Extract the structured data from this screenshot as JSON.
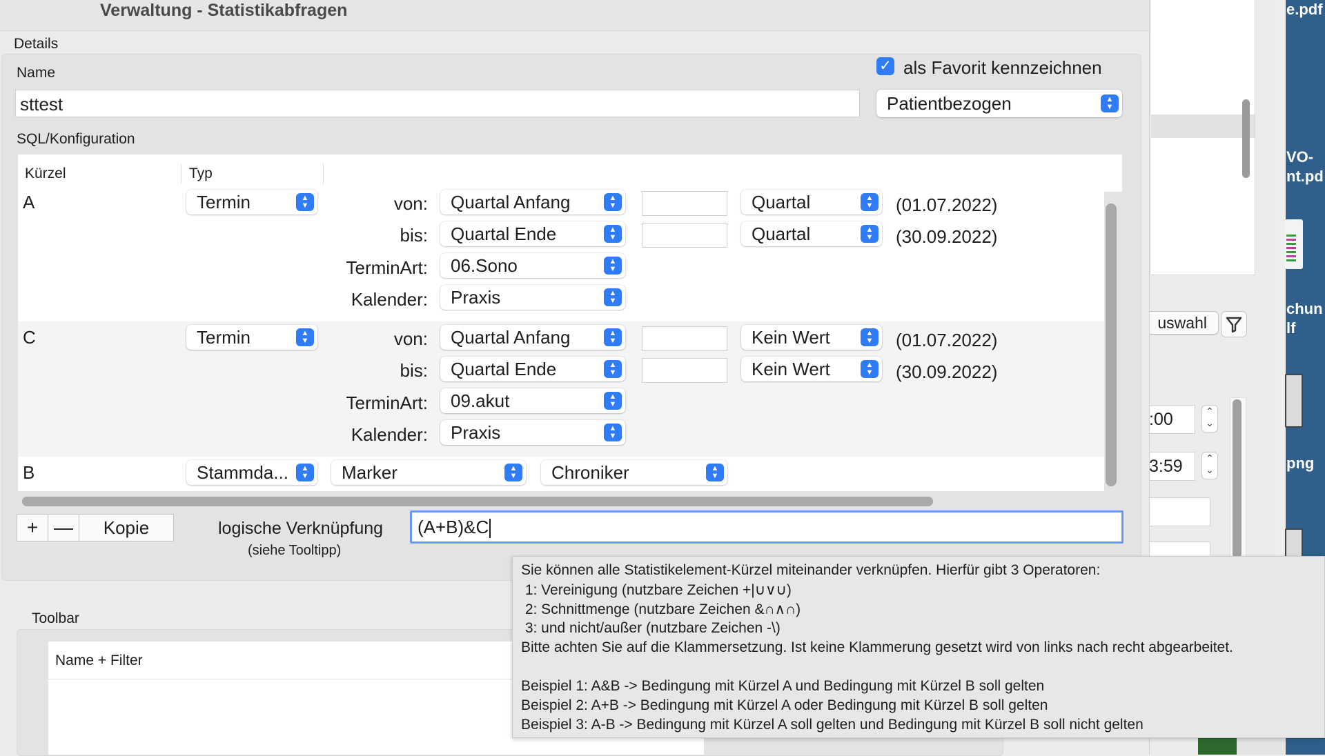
{
  "window": {
    "title": "Verwaltung - Statistikabfragen"
  },
  "details": {
    "section_label": "Details",
    "name_label": "Name",
    "name_value": "sttest",
    "favorite_label": "als Favorit kennzeichnen",
    "favorite_checked": true,
    "scope_select": "Patientbezogen",
    "sql_label": "SQL/Konfiguration"
  },
  "table": {
    "headers": {
      "kuerzel": "Kürzel",
      "typ": "Typ"
    },
    "row_a": {
      "kuerzel": "A",
      "typ": "Termin",
      "von_label": "von:",
      "von_select": "Quartal Anfang",
      "von_unit": "Quartal",
      "von_date": "(01.07.2022)",
      "bis_label": "bis:",
      "bis_select": "Quartal Ende",
      "bis_unit": "Quartal",
      "bis_date": "(30.09.2022)",
      "terminart_label": "TerminArt:",
      "terminart_select": "06.Sono",
      "kalender_label": "Kalender:",
      "kalender_select": "Praxis"
    },
    "row_c": {
      "kuerzel": "C",
      "typ": "Termin",
      "von_label": "von:",
      "von_select": "Quartal Anfang",
      "von_unit": "Kein Wert",
      "von_date": "(01.07.2022)",
      "bis_label": "bis:",
      "bis_select": "Quartal Ende",
      "bis_unit": "Kein Wert",
      "bis_date": "(30.09.2022)",
      "terminart_label": "TerminArt:",
      "terminart_select": "09.akut",
      "kalender_label": "Kalender:",
      "kalender_select": "Praxis"
    },
    "row_b": {
      "kuerzel": "B",
      "typ": "Stammda...",
      "field_select": "Marker",
      "value_select": "Chroniker"
    }
  },
  "controls": {
    "add": "+",
    "remove": "—",
    "copy": "Kopie",
    "logic_label": "logische Verknüpfung",
    "logic_hint": "(siehe Tooltipp)",
    "logic_value": "(A+B)&C"
  },
  "toolbar_section": {
    "label": "Toolbar",
    "column_header": "Name + Filter"
  },
  "tooltip": {
    "lines": [
      "Sie können alle Statistikelement-Kürzel miteinander verknüpfen. Hierfür gibt 3 Operatoren:",
      " 1: Vereinigung (nutzbare Zeichen +|∪∨∪)",
      " 2: Schnittmenge (nutzbare Zeichen &∩∧∩)",
      " 3: und nicht/außer (nutzbare Zeichen -\\)",
      "Bitte achten Sie auf die Klammersetzung. Ist keine Klammerung gesetzt wird von links nach recht abgearbeitet.",
      "",
      "Beispiel 1: A&B -> Bedingung mit Kürzel A und Bedingung mit Kürzel B soll gelten",
      "Beispiel 2: A+B -> Bedingung mit Kürzel A oder Bedingung mit Kürzel B soll gelten",
      "Beispiel 3: A-B -> Bedingung mit Kürzel A soll gelten und Bedingung mit Kürzel B soll nicht gelten"
    ]
  },
  "background": {
    "desktop_texts": [
      "e.pdf",
      "VO-\nnt.pd",
      "chun\nlf",
      "png"
    ],
    "auswahl_button": "uswahl",
    "time1": ":00",
    "time2": "3:59"
  },
  "colors": {
    "accent": "#2f7cf6",
    "focus_ring": "#6a9bf3",
    "tooltip_bg": "#e7e7e7"
  }
}
